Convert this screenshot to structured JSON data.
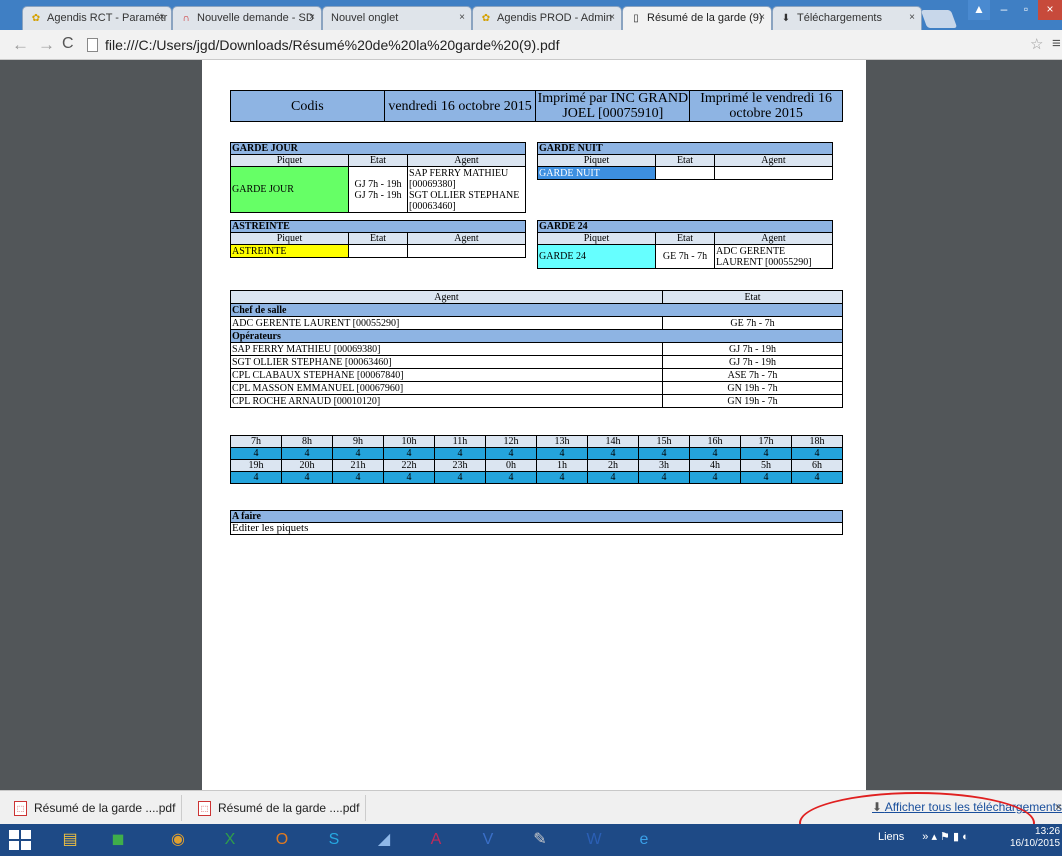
{
  "tabs": [
    {
      "label": "Agendis RCT - Paramétr",
      "icon": "agendis-icon"
    },
    {
      "label": "Nouvelle demande - SD",
      "icon": "red-arc-icon"
    },
    {
      "label": "Nouvel onglet",
      "icon": ""
    },
    {
      "label": "Agendis PROD - Admin",
      "icon": "agendis-icon"
    },
    {
      "label": "Résumé de la garde (9)",
      "icon": "page-icon"
    },
    {
      "label": "Téléchargements",
      "icon": "download-icon"
    }
  ],
  "address": "file:///C:/Users/jgd/Downloads/Résumé%20de%20la%20garde%20(9).pdf",
  "doc": {
    "header": {
      "site": "Codis",
      "date": "vendredi 16 octobre 2015",
      "printed_by": "Imprimé par INC GRAND JOEL [00075910]",
      "printed_on": "Imprimé le vendredi 16 octobre 2015"
    },
    "cols": {
      "piquet": "Piquet",
      "etat": "Etat",
      "agent": "Agent"
    },
    "garde_jour": {
      "title": "GARDE JOUR",
      "piquet": "GARDE JOUR",
      "etat1": "GJ 7h - 19h",
      "etat2": "GJ 7h - 19h",
      "agent1": "SAP FERRY MATHIEU [00069380]",
      "agent2": "SGT OLLIER STEPHANE [00063460]"
    },
    "garde_nuit": {
      "title": "GARDE NUIT",
      "piquet": "GARDE NUIT"
    },
    "astreinte": {
      "title": "ASTREINTE",
      "piquet": "ASTREINTE"
    },
    "garde24": {
      "title": "GARDE 24",
      "piquet": "GARDE 24",
      "etat": "GE 7h - 7h",
      "agent": "ADC GERENTE LAURENT [00055290]"
    },
    "agents": {
      "col_agent": "Agent",
      "col_etat": "Etat",
      "chef_title": "Chef de salle",
      "chef": [
        {
          "name": "ADC GERENTE LAURENT [00055290]",
          "etat": "GE 7h - 7h"
        }
      ],
      "ops_title": "Opérateurs",
      "ops": [
        {
          "name": "SAP FERRY MATHIEU [00069380]",
          "etat": "GJ 7h - 19h"
        },
        {
          "name": "SGT OLLIER STEPHANE [00063460]",
          "etat": "GJ 7h - 19h"
        },
        {
          "name": "CPL CLABAUX STEPHANE [00067840]",
          "etat": "ASE 7h - 7h"
        },
        {
          "name": "CPL MASSON EMMANUEL [00067960]",
          "etat": "GN 19h - 7h"
        },
        {
          "name": "CPL ROCHE ARNAUD [00010120]",
          "etat": "GN 19h - 7h"
        }
      ]
    },
    "hours_row1": [
      "7h",
      "8h",
      "9h",
      "10h",
      "11h",
      "12h",
      "13h",
      "14h",
      "15h",
      "16h",
      "17h",
      "18h"
    ],
    "counts_row1": [
      "4",
      "4",
      "4",
      "4",
      "4",
      "4",
      "4",
      "4",
      "4",
      "4",
      "4",
      "4"
    ],
    "hours_row2": [
      "19h",
      "20h",
      "21h",
      "22h",
      "23h",
      "0h",
      "1h",
      "2h",
      "3h",
      "4h",
      "5h",
      "6h"
    ],
    "counts_row2": [
      "4",
      "4",
      "4",
      "4",
      "4",
      "4",
      "4",
      "4",
      "4",
      "4",
      "4",
      "4"
    ],
    "todo": {
      "title": "A faire",
      "text": "Editer les piquets"
    }
  },
  "downloads": {
    "items": [
      "Résumé de la garde ....pdf",
      "Résumé de la garde ....pdf"
    ],
    "show_all": "Afficher tous les téléchargements"
  },
  "taskbar": {
    "tray_label": "Liens",
    "time": "13:26",
    "date": "16/10/2015"
  }
}
